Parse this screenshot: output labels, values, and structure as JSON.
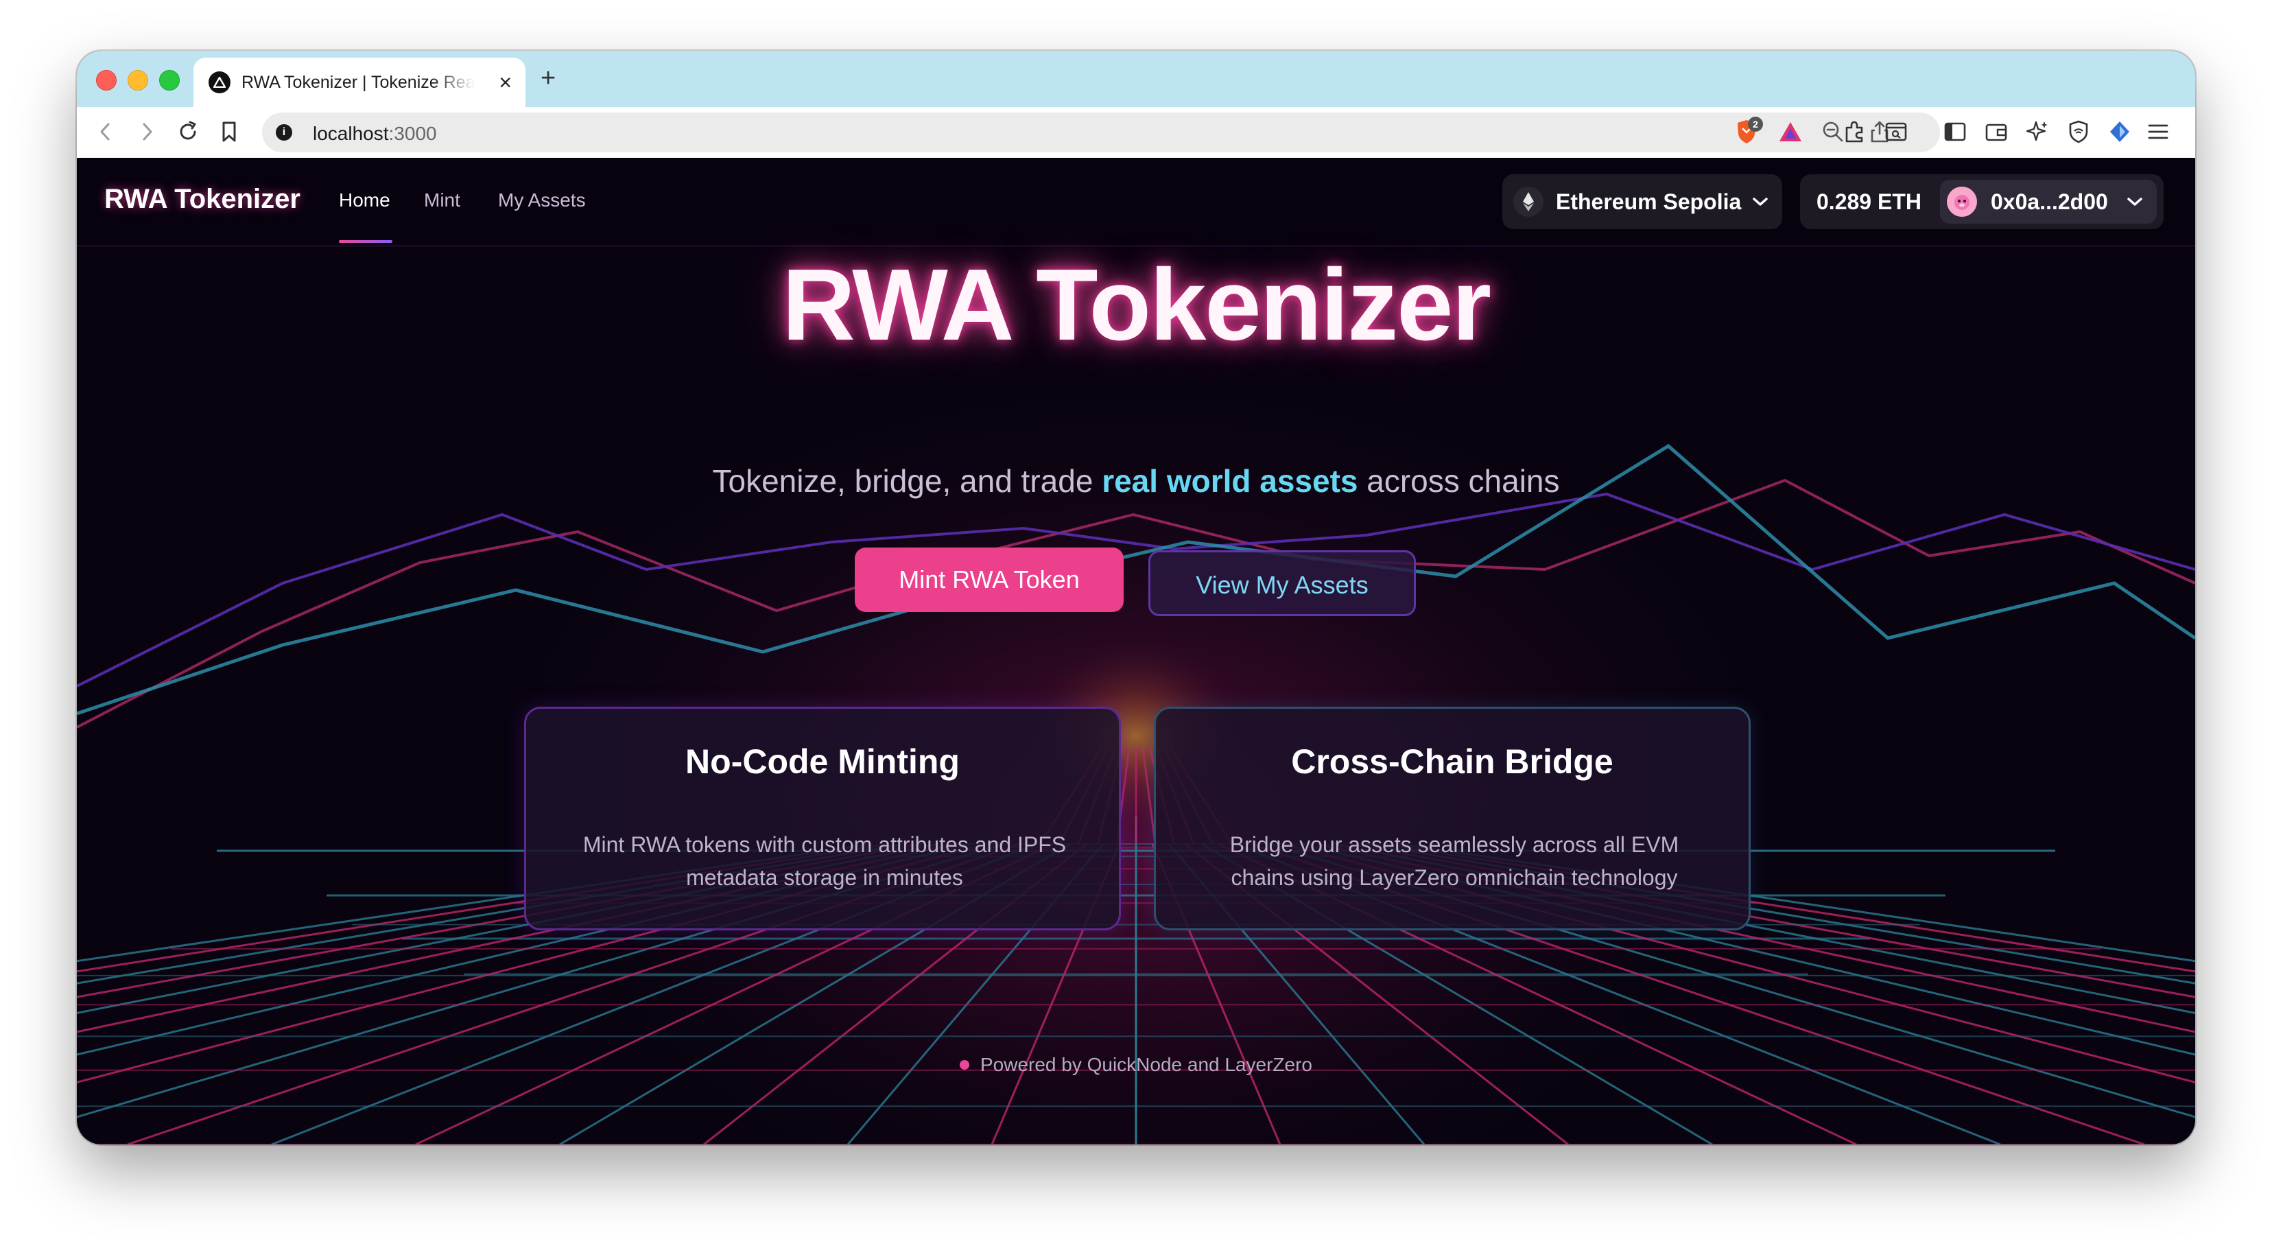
{
  "browser": {
    "tab_title": "RWA Tokenizer | Tokenize Real World Assets",
    "url_host": "localhost",
    "url_port": ":3000",
    "brave_shield_count": "2"
  },
  "nav": {
    "brand": "RWA Tokenizer",
    "links": [
      "Home",
      "Mint",
      "My Assets"
    ],
    "active": "Home",
    "network": "Ethereum Sepolia",
    "balance": "0.289 ETH",
    "account": "0x0a...2d00"
  },
  "hero": {
    "title": "RWA Tokenizer",
    "subtitle_pre": "Tokenize, bridge, and trade ",
    "subtitle_highlight": "real world assets",
    "subtitle_post": " across chains",
    "primary_button": "Mint RWA Token",
    "secondary_button": "View My Assets"
  },
  "features": [
    {
      "title": "No-Code Minting",
      "text": "Mint RWA tokens with custom attributes and IPFS metadata storage in minutes"
    },
    {
      "title": "Cross-Chain Bridge",
      "text": "Bridge your assets seamlessly across all EVM chains using LayerZero omnichain technology"
    }
  ],
  "footer": {
    "powered_by": "Powered by QuickNode and LayerZero"
  },
  "colors": {
    "accent_pink": "#ec3f8c",
    "accent_cyan": "#67d8f2",
    "accent_purple": "#5e35a6",
    "background": "#0a0312"
  }
}
